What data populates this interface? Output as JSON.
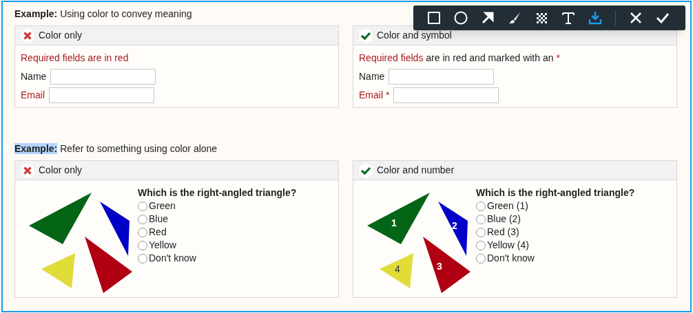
{
  "toolbar": {
    "tools": [
      {
        "kind": "rectangle",
        "selected": false
      },
      {
        "kind": "ellipse",
        "selected": false
      },
      {
        "kind": "arrow",
        "selected": false
      },
      {
        "kind": "brush",
        "selected": false
      },
      {
        "kind": "mosaic",
        "selected": false
      },
      {
        "kind": "text",
        "selected": false
      },
      {
        "kind": "save",
        "selected": true
      },
      {
        "kind": "cancel",
        "selected": false
      },
      {
        "kind": "confirm",
        "selected": false
      }
    ]
  },
  "sections": [
    {
      "heading": {
        "label": "Example:",
        "highlighted": false,
        "text": "Using color to convey meaning"
      },
      "cards": [
        {
          "header": {
            "kind": "bad",
            "title": "Color only"
          },
          "kind": "form",
          "intro": [
            {
              "text": "Required fields are in red",
              "required": true
            }
          ],
          "fields": [
            {
              "label": "Name",
              "required": false
            },
            {
              "label": "Email",
              "required": true
            }
          ]
        },
        {
          "header": {
            "kind": "good",
            "title": "Color and symbol"
          },
          "kind": "form",
          "intro": [
            {
              "text": "Required fields",
              "required": true
            },
            {
              "text": "are in red and marked with an",
              "required": false
            },
            {
              "text": "*",
              "required": true
            }
          ],
          "fields": [
            {
              "label": "Name",
              "required": false
            },
            {
              "label": "Email",
              "required": true,
              "marker": "*"
            }
          ]
        }
      ]
    },
    {
      "heading": {
        "label": "Example:",
        "highlighted": true,
        "text": "Refer to something using color alone"
      },
      "cards": [
        {
          "header": {
            "kind": "bad",
            "title": "Color only"
          },
          "kind": "quiz",
          "triangles": [
            {
              "color": "#056517"
            },
            {
              "color": "#0000c8"
            },
            {
              "color": "#e0dc38"
            },
            {
              "color": "#b00012"
            }
          ],
          "question": "Which is the right-angled triangle?",
          "options": [
            {
              "label": "Green",
              "checked": false
            },
            {
              "label": "Blue",
              "checked": false
            },
            {
              "label": "Red",
              "checked": false
            },
            {
              "label": "Yellow",
              "checked": false
            },
            {
              "label": "Don't know",
              "checked": false
            }
          ]
        },
        {
          "header": {
            "kind": "good",
            "title": "Color and number"
          },
          "kind": "quiz",
          "triangles": [
            {
              "color": "#056517",
              "number": "1"
            },
            {
              "color": "#0000c8",
              "number": "2"
            },
            {
              "color": "#e0dc38",
              "number": "4"
            },
            {
              "color": "#b00012",
              "number": "3"
            }
          ],
          "question": "Which is the right-angled triangle?",
          "options": [
            {
              "label": "Green (1)",
              "checked": false
            },
            {
              "label": "Blue (2)",
              "checked": false
            },
            {
              "label": "Red (3)",
              "checked": false
            },
            {
              "label": "Yellow (4)",
              "checked": false
            },
            {
              "label": "Don't know",
              "checked": false
            }
          ]
        }
      ]
    }
  ]
}
